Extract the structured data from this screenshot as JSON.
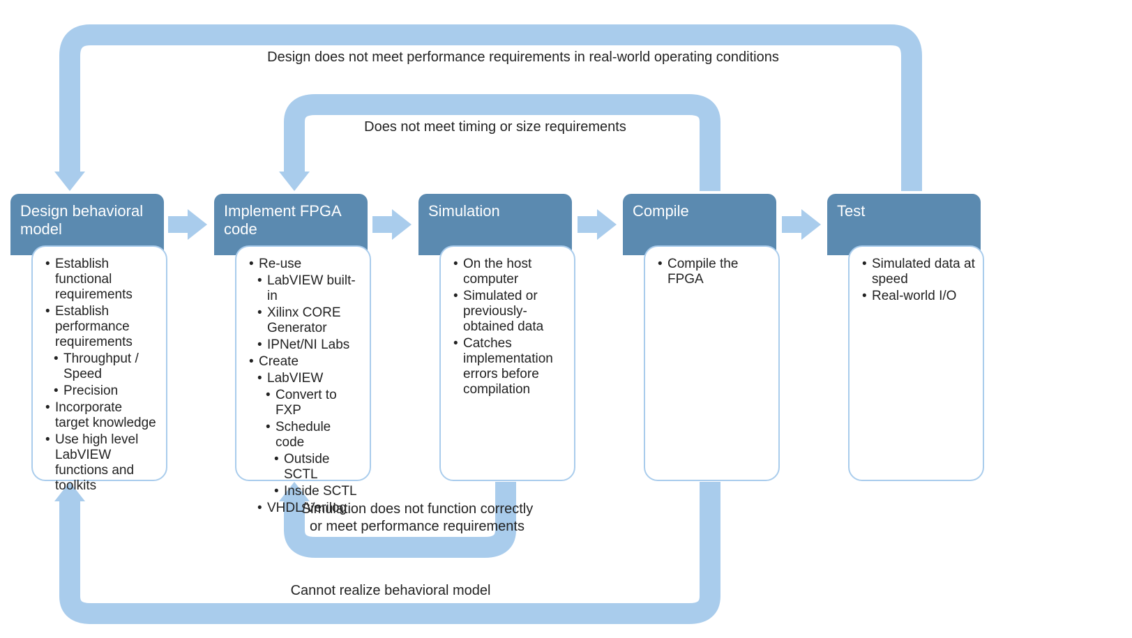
{
  "colors": {
    "arrow": "#a9ccec",
    "title_bg": "#5b8ab0",
    "border": "#a9ccec"
  },
  "nodes": {
    "design": {
      "title": "Design behavioral model"
    },
    "implement": {
      "title": "Implement FPGA code"
    },
    "simulation": {
      "title": "Simulation"
    },
    "compile": {
      "title": "Compile"
    },
    "test": {
      "title": "Test"
    }
  },
  "bullets": {
    "design": {
      "b1": "Establish functional requirements",
      "b2": "Establish performance requirements",
      "b2a": "Throughput / Speed",
      "b2b": "Precision",
      "b3": "Incorporate target knowledge",
      "b4": "Use high level LabVIEW  functions and toolkits"
    },
    "implement": {
      "b1": "Re-use",
      "b1a": "LabVIEW built-in",
      "b1b": "Xilinx CORE Generator",
      "b1c": "IPNet/NI Labs",
      "b2": "Create",
      "b2a": "LabVIEW",
      "b2a1": "Convert to FXP",
      "b2a2": "Schedule code",
      "b2a2a": "Outside SCTL",
      "b2a2b": "Inside SCTL",
      "b2b": "VHDL/Verilog"
    },
    "simulation": {
      "b1": "On the host computer",
      "b2": "Simulated or previously-obtained data",
      "b3": "Catches implementation errors before compilation"
    },
    "compile": {
      "b1": "Compile the FPGA"
    },
    "test": {
      "b1": "Simulated data at speed",
      "b2": "Real-world I/O"
    }
  },
  "feedback": {
    "top1": "Design does not meet performance requirements in real-world operating conditions",
    "top2": "Does not meet timing or size requirements",
    "bot1": "Simulation does not function correctly or meet performance requirements",
    "bot2": "Cannot realize behavioral model"
  }
}
